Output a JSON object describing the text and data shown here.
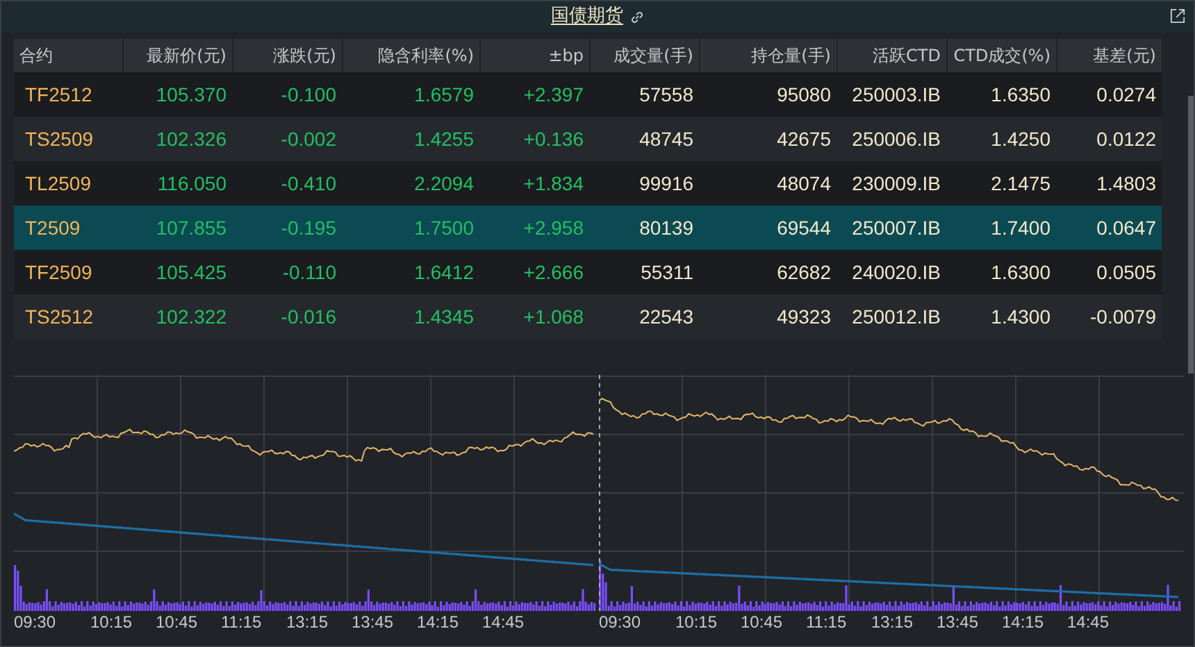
{
  "title": "国债期货",
  "table": {
    "columns": [
      "合约",
      "最新价(元)",
      "涨跌(元)",
      "隐含利率(%)",
      "±bp",
      "成交量(手)",
      "持仓量(手)",
      "活跃CTD",
      "CTD成交(%)",
      "基差(元)"
    ],
    "rows": [
      {
        "selected": false,
        "cells": [
          "TF2512",
          "105.370",
          "-0.100",
          "1.6579",
          "+2.397",
          "57558",
          "95080",
          "250003.IB",
          "1.6350",
          "0.0274"
        ]
      },
      {
        "selected": false,
        "cells": [
          "TS2509",
          "102.326",
          "-0.002",
          "1.4255",
          "+0.136",
          "48745",
          "42675",
          "250006.IB",
          "1.4250",
          "0.0122"
        ]
      },
      {
        "selected": false,
        "cells": [
          "TL2509",
          "116.050",
          "-0.410",
          "2.2094",
          "+1.834",
          "99916",
          "48074",
          "230009.IB",
          "2.1475",
          "1.4803"
        ]
      },
      {
        "selected": true,
        "cells": [
          "T2509",
          "107.855",
          "-0.195",
          "1.7500",
          "+2.958",
          "80139",
          "69544",
          "250007.IB",
          "1.7400",
          "0.0647"
        ]
      },
      {
        "selected": false,
        "cells": [
          "TF2509",
          "105.425",
          "-0.110",
          "1.6412",
          "+2.666",
          "55311",
          "62682",
          "240020.IB",
          "1.6300",
          "0.0505"
        ]
      },
      {
        "selected": false,
        "cells": [
          "TS2512",
          "102.322",
          "-0.016",
          "1.4345",
          "+1.068",
          "22543",
          "49323",
          "250012.IB",
          "1.4300",
          "-0.0079"
        ]
      }
    ]
  },
  "chart": {
    "days": [
      {
        "time_labels": [
          "09:30",
          "10:15",
          "10:45",
          "11:15",
          "13:15",
          "13:45",
          "14:15",
          "14:45"
        ]
      },
      {
        "time_labels": [
          "09:30",
          "10:15",
          "10:45",
          "11:15",
          "13:15",
          "13:45",
          "14:15",
          "14:45"
        ]
      }
    ]
  }
}
